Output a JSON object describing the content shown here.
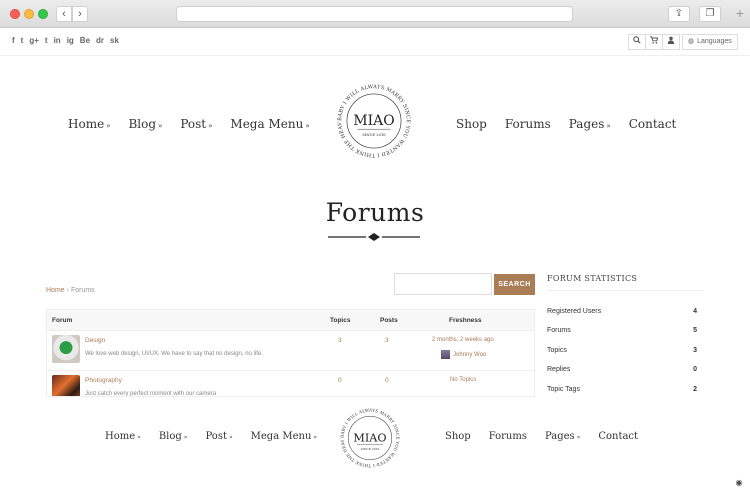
{
  "social_icons": [
    "f",
    "t",
    "g+",
    "t",
    "in",
    "ig",
    "Be",
    "dr",
    "sk"
  ],
  "toolbar": {
    "languages_label": "Languages",
    "search_icon": "search-icon",
    "cart_icon": "cart-icon",
    "user_icon": "user-icon"
  },
  "nav_left": [
    {
      "label": "Home",
      "dropdown": "»"
    },
    {
      "label": "Blog",
      "dropdown": "»"
    },
    {
      "label": "Post",
      "dropdown": "»"
    },
    {
      "label": "Mega Menu",
      "dropdown": "»"
    }
  ],
  "nav_right": [
    {
      "label": "Shop",
      "dropdown": ""
    },
    {
      "label": "Forums",
      "dropdown": ""
    },
    {
      "label": "Pages",
      "dropdown": "»"
    },
    {
      "label": "Contact",
      "dropdown": ""
    }
  ],
  "logo": {
    "name": "MIAO",
    "since": "SINCE 2016",
    "ring_text": "BABY I WILL ALWAYS MARRY SINCE YOU WANTED I THINK THE HEAVEN IS ABOVE ME THANK YOU"
  },
  "page_title": "Forums",
  "breadcrumb": {
    "home": "Home",
    "sep": "›",
    "current": "Forums"
  },
  "search": {
    "placeholder": "",
    "button": "SEARCH"
  },
  "table": {
    "headers": {
      "forum": "Forum",
      "topics": "Topics",
      "posts": "Posts",
      "freshness": "Freshness"
    },
    "rows": [
      {
        "name": "Design",
        "desc": "We love web design, UI/UX. We have to say that no design, no life.",
        "topics": "3",
        "posts": "3",
        "freshness": "2 months, 2 weeks ago",
        "author": "Johnny Woo"
      },
      {
        "name": "Photography",
        "desc": "Just catch every perfect moment with our camera",
        "topics": "0",
        "posts": "0",
        "freshness": "No Topics",
        "author": ""
      }
    ]
  },
  "stats": {
    "title": "FORUM STATISTICS",
    "items": [
      {
        "label": "Registered Users",
        "value": "4"
      },
      {
        "label": "Forums",
        "value": "5"
      },
      {
        "label": "Topics",
        "value": "3"
      },
      {
        "label": "Replies",
        "value": "0"
      },
      {
        "label": "Topic Tags",
        "value": "2"
      }
    ]
  },
  "accent_color": "#a97d55"
}
